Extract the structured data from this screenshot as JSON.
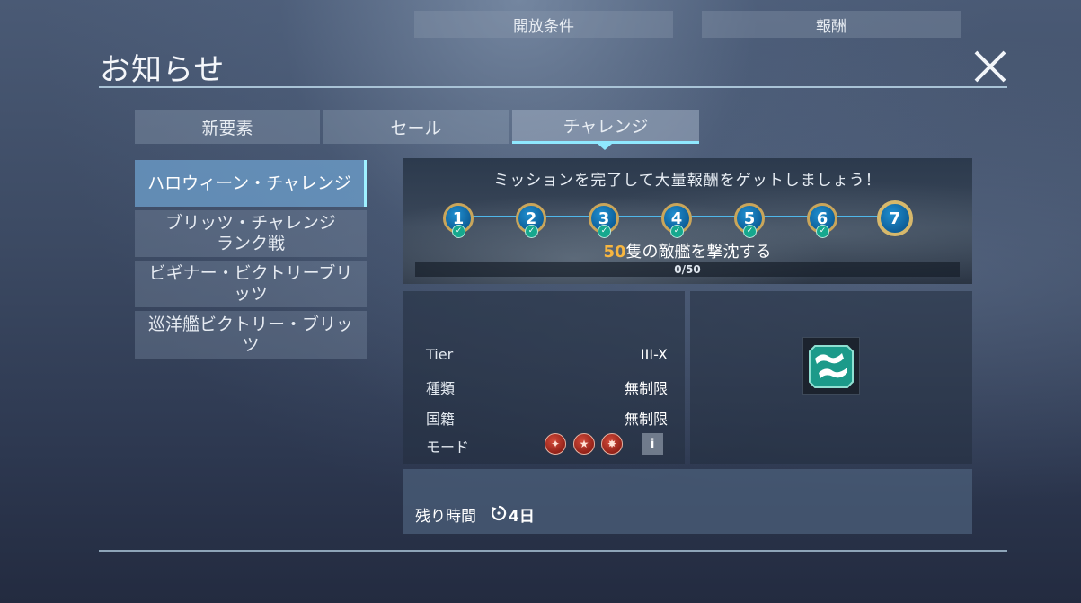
{
  "header": {
    "title": "お知らせ",
    "close_icon": "close-icon"
  },
  "tabs": [
    {
      "label": "新要素",
      "active": false
    },
    {
      "label": "セール",
      "active": false
    },
    {
      "label": "チャレンジ",
      "active": true
    }
  ],
  "sidebar": {
    "items": [
      {
        "label": "ハロウィーン・チャレンジ",
        "active": true
      },
      {
        "label_line1": "ブリッツ・チャレンジ",
        "label_line2": "ランク戦",
        "active": false
      },
      {
        "label_line1": "ビギナー・ビクトリーブリ",
        "label_line2": "ッツ",
        "active": false
      },
      {
        "label_line1": "巡洋艦ビクトリー・ブリッ",
        "label_line2": "ツ",
        "active": false
      }
    ]
  },
  "banner": {
    "title": "ミッションを完了して大量報酬をゲットしましょう！",
    "steps": [
      {
        "label": "1",
        "completed": true
      },
      {
        "label": "2",
        "completed": true
      },
      {
        "label": "3",
        "completed": true
      },
      {
        "label": "4",
        "completed": true
      },
      {
        "label": "5",
        "completed": true
      },
      {
        "label": "6",
        "completed": true
      },
      {
        "label": "7",
        "completed": false
      }
    ],
    "mission_count": "50",
    "mission_text": "隻の敵艦を撃沈する",
    "progress_text": "0/50",
    "progress_fraction": 0
  },
  "conditions": {
    "heading": "開放条件",
    "tier_label": "Tier",
    "tier_value": "III-X",
    "type_label": "種類",
    "type_value": "無制限",
    "nation_label": "国籍",
    "nation_value": "無制限",
    "mode_label": "モード",
    "mode_icons": [
      "mode-standard-icon",
      "mode-ranked-icon",
      "mode-special-icon"
    ],
    "info_label": "i"
  },
  "reward": {
    "heading": "報酬",
    "icon": "camouflage-reward-icon"
  },
  "footer": {
    "time_label": "残り時間",
    "time_value": "4日"
  },
  "colors": {
    "accent": "#8fe8ff",
    "highlight": "#f7b640",
    "step_blue": "#1f8fd0",
    "step_gold": "#c9a55a"
  }
}
